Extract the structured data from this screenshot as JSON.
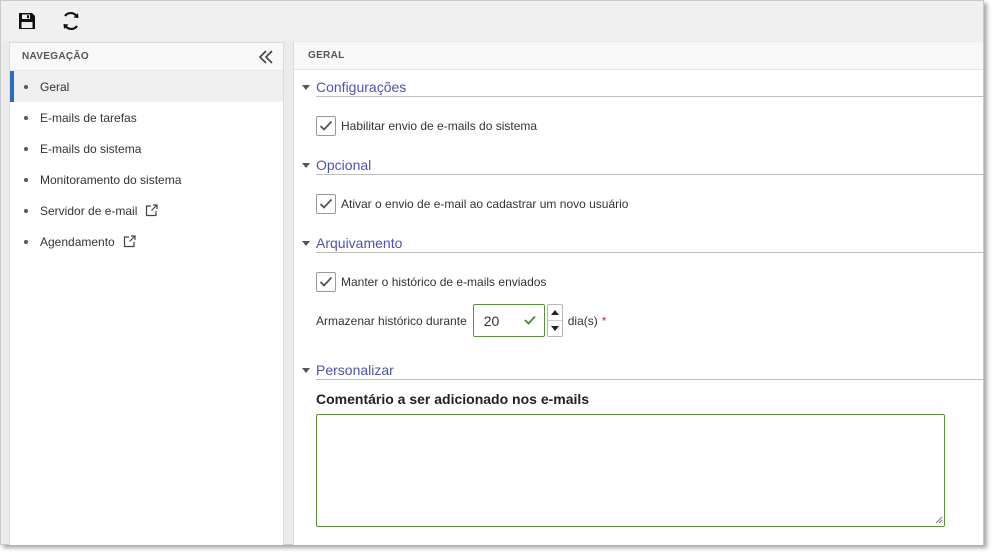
{
  "toolbar": {
    "save_icon": "floppy-disk-icon",
    "refresh_icon": "refresh-icon"
  },
  "sidebar": {
    "header": "NAVEGAÇÃO",
    "collapse_icon": "double-chevron-left-icon",
    "items": [
      {
        "label": "Geral",
        "active": true
      },
      {
        "label": "E-mails de tarefas"
      },
      {
        "label": "E-mails do sistema"
      },
      {
        "label": "Monitoramento do sistema"
      },
      {
        "label": "Servidor de e-mail",
        "external": true
      },
      {
        "label": "Agendamento",
        "external": true
      }
    ]
  },
  "main": {
    "header": "GERAL",
    "sections": {
      "config": {
        "title": "Configurações",
        "checkbox_label": "Habilitar envio de e-mails do sistema",
        "checked": true
      },
      "optional": {
        "title": "Opcional",
        "checkbox_label": "Ativar o envio de e-mail ao cadastrar um novo usuário",
        "checked": true
      },
      "archive": {
        "title": "Arquivamento",
        "checkbox_label": "Manter o histórico de e-mails enviados",
        "checked": true,
        "store_label": "Armazenar histórico durante",
        "store_value": "20",
        "store_unit": "dia(s)",
        "required_mark": "*"
      },
      "custom": {
        "title": "Personalizar",
        "comment_label": "Comentário a ser adicionado nos e-mails",
        "comment_value": ""
      }
    }
  },
  "colors": {
    "accent": "#2a6ebb",
    "section_title": "#4a56a8",
    "valid_border": "#5e8f3a",
    "required": "#d0202f"
  }
}
